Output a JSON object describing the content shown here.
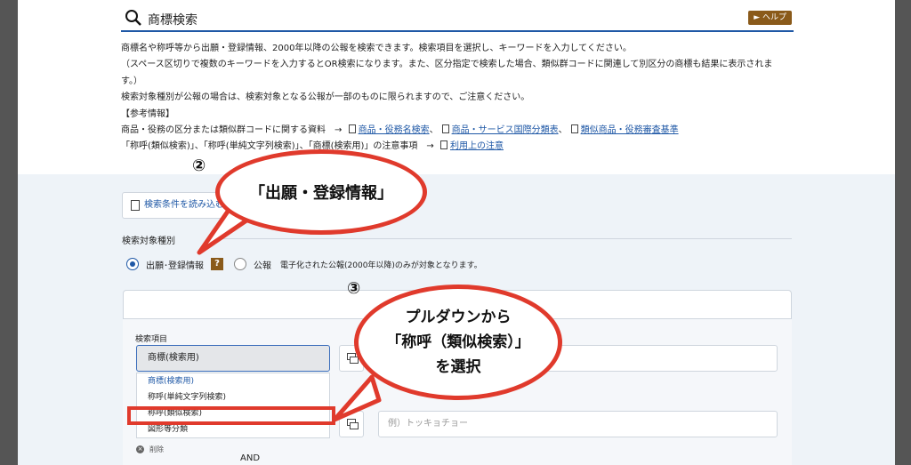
{
  "header": {
    "title": "商標検索",
    "help_label": "► ヘルプ"
  },
  "description": {
    "line1": "商標名や称呼等から出願・登録情報、2000年以降の公報を検索できます。検索項目を選択し、キーワードを入力してください。",
    "line2": "（スペース区切りで複数のキーワードを入力するとOR検索になります。また、区分指定で検索した場合、類似群コードに関連して別区分の商標も結果に表示されま",
    "line3": "す。）",
    "line4": "検索対象種別が公報の場合は、検索対象となる公報が一部のものに限られますので、ご注意ください。",
    "line5": "【参考情報】",
    "ref1_prefix": "商品・役務の区分または類似群コードに関する資料　→",
    "ref1_link1": "商品・役務名検索",
    "ref1_link2": "商品・サービス国際分類表",
    "ref1_link3": "類似商品・役務審査基準",
    "ref2_prefix": "「称呼(類似検索)」、「称呼(単純文字列検索)」、「商標(検索用)」の注意事項　→",
    "ref2_link": "利用上の注意"
  },
  "load_button": "検索条件を読み込む",
  "search_target": {
    "label": "検索対象種別",
    "option1": "出願･登録情報",
    "option2": "公報",
    "note": "電子化された公報(2000年以降)のみが対象となります。",
    "help_badge": "?"
  },
  "search_item": {
    "label": "検索項目",
    "selected": "商標(検索用)",
    "options": [
      "商標(検索用)",
      "称呼(単純文字列検索)",
      "称呼(類似検索)",
      "図形等分類"
    ],
    "placeholder2": "例）トッキョチョー"
  },
  "delete_label": "削除",
  "and_label": "AND",
  "annotations": {
    "num2": "②",
    "num3": "③",
    "bubble1": "「出願・登録情報」",
    "bubble2_line1": "プルダウンから",
    "bubble2_line2": "「称呼（類似検索）」",
    "bubble2_line3": "を選択"
  },
  "colors": {
    "accent": "#1f58a6",
    "help": "#8a5a1a",
    "annotation_red": "#e03a2c",
    "lower_bg": "#eef3f8"
  }
}
